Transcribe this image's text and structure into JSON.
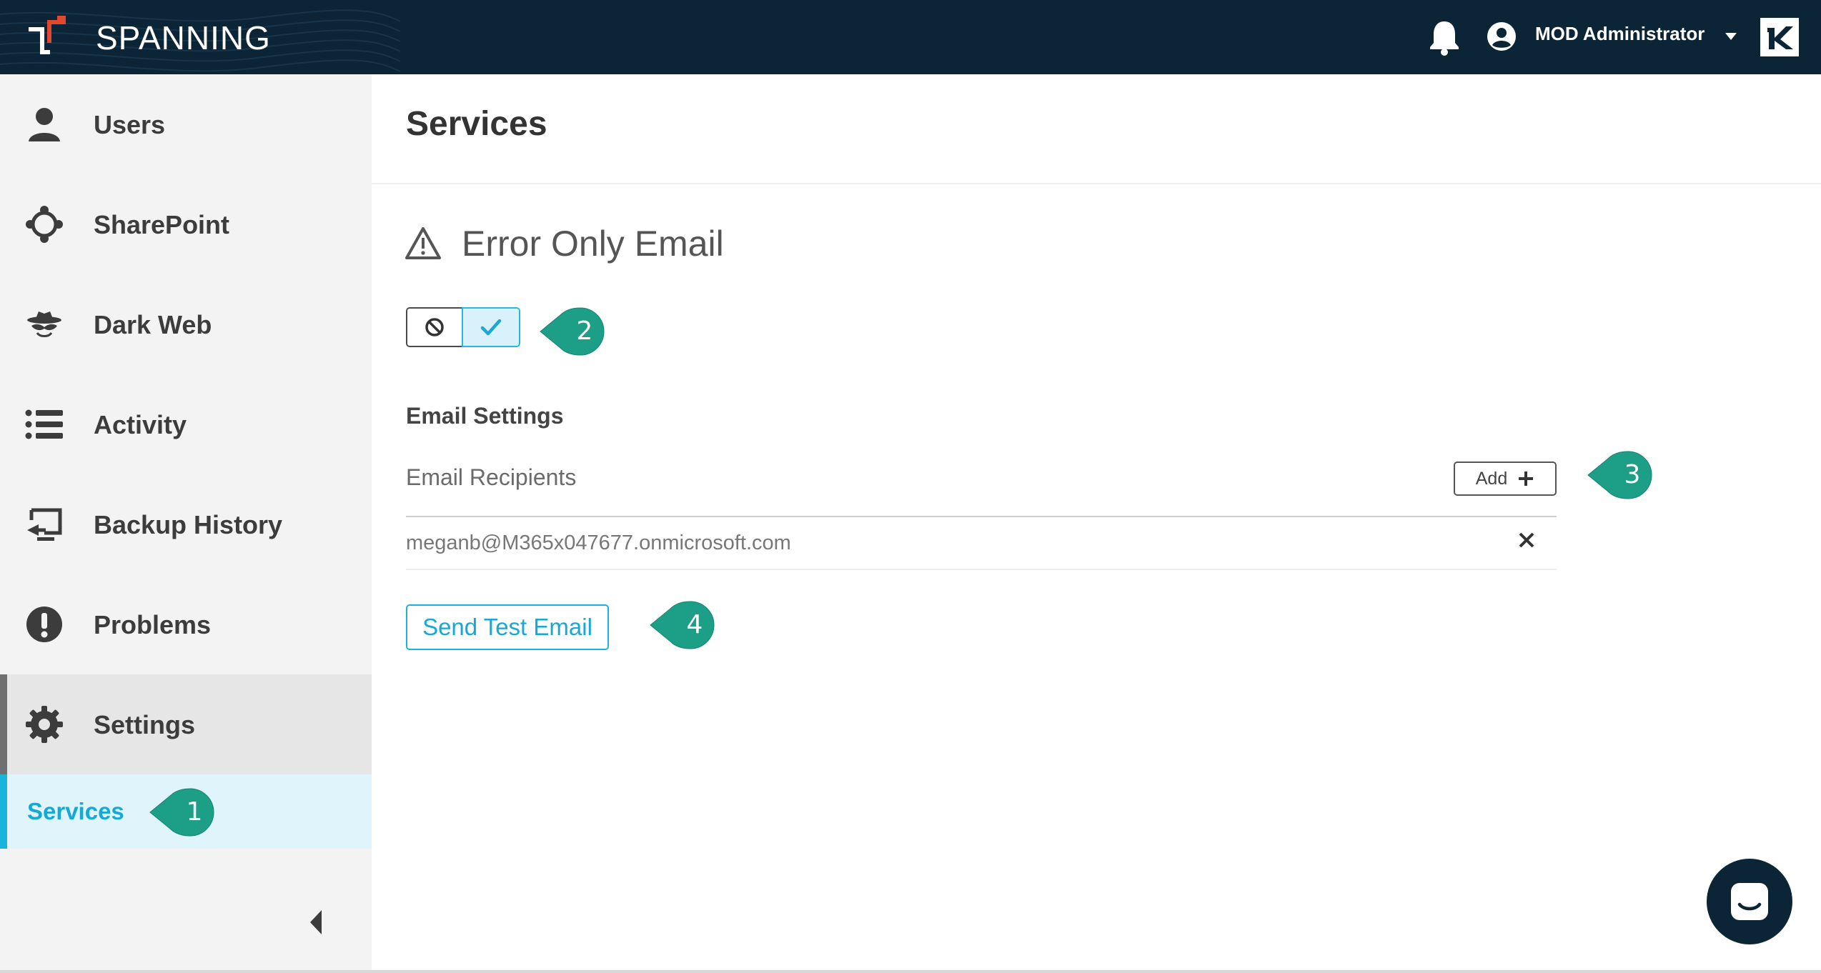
{
  "app": {
    "brand": "SPANNING",
    "user_name": "MOD Administrator",
    "colors": {
      "topbar": "#0c2536",
      "accent": "#1ab3dc",
      "logo_red": "#e2472f",
      "callout": "#1d9e86"
    }
  },
  "sidebar": {
    "items": [
      {
        "label": "Users",
        "icon": "user-icon"
      },
      {
        "label": "SharePoint",
        "icon": "sharepoint-icon"
      },
      {
        "label": "Dark Web",
        "icon": "spy-icon"
      },
      {
        "label": "Activity",
        "icon": "list-icon"
      },
      {
        "label": "Backup History",
        "icon": "backup-icon"
      },
      {
        "label": "Problems",
        "icon": "exclamation-icon"
      },
      {
        "label": "Settings",
        "icon": "gear-icon",
        "active": true
      }
    ],
    "sub_item": {
      "label": "Services",
      "active": true
    }
  },
  "main": {
    "page_title": "Services",
    "section_title": "Error Only Email",
    "toggle": {
      "state": "on"
    },
    "email_settings_title": "Email Settings",
    "recipients_label": "Email Recipients",
    "add_label": "Add",
    "recipients": [
      "meganb@M365x047677.onmicrosoft.com"
    ],
    "send_test_label": "Send Test Email"
  },
  "callouts": [
    "1",
    "2",
    "3",
    "4"
  ]
}
